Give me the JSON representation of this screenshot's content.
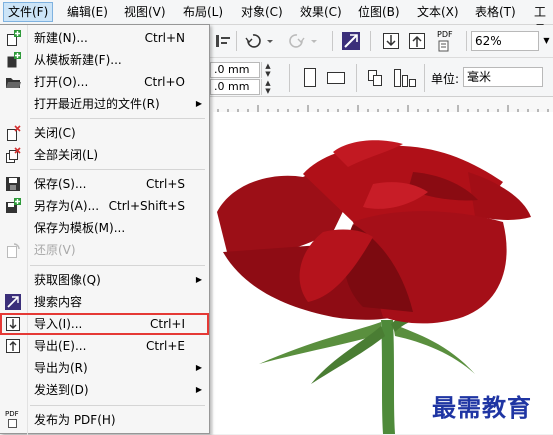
{
  "menubar": {
    "items": [
      "文件(F)",
      "编辑(E)",
      "视图(V)",
      "布局(L)",
      "对象(C)",
      "效果(C)",
      "位图(B)",
      "文本(X)",
      "表格(T)",
      "工具"
    ]
  },
  "toolbar": {
    "pdf_label": "PDF",
    "zoom_value": "62%",
    "width_value": ".0 mm",
    "height_value": ".0 mm",
    "units_label": "单位:",
    "units_value": "毫米"
  },
  "file_menu": {
    "items": [
      {
        "label": "新建(N)...",
        "shortcut": "Ctrl+N"
      },
      {
        "label": "从模板新建(F)...",
        "shortcut": ""
      },
      {
        "label": "打开(O)...",
        "shortcut": "Ctrl+O"
      },
      {
        "label": "打开最近用过的文件(R)",
        "shortcut": ""
      },
      {
        "label": "关闭(C)",
        "shortcut": ""
      },
      {
        "label": "全部关闭(L)",
        "shortcut": ""
      },
      {
        "label": "保存(S)...",
        "shortcut": "Ctrl+S"
      },
      {
        "label": "另存为(A)...",
        "shortcut": "Ctrl+Shift+S"
      },
      {
        "label": "保存为模板(M)...",
        "shortcut": ""
      },
      {
        "label": "还原(V)",
        "shortcut": ""
      },
      {
        "label": "获取图像(Q)",
        "shortcut": ""
      },
      {
        "label": "搜索内容",
        "shortcut": ""
      },
      {
        "label": "导入(I)...",
        "shortcut": "Ctrl+I"
      },
      {
        "label": "导出(E)...",
        "shortcut": "Ctrl+E"
      },
      {
        "label": "导出为(R)",
        "shortcut": ""
      },
      {
        "label": "发送到(D)",
        "shortcut": ""
      },
      {
        "label": "发布为 PDF(H)",
        "shortcut": ""
      }
    ],
    "pdf_icon_label": "PDF"
  },
  "watermark": "最需教育",
  "colors": {
    "menu_highlight_border": "#e53935",
    "rose_red": "#b01018",
    "stem_green": "#4e8a3a",
    "watermark_blue": "#1f35a3"
  }
}
